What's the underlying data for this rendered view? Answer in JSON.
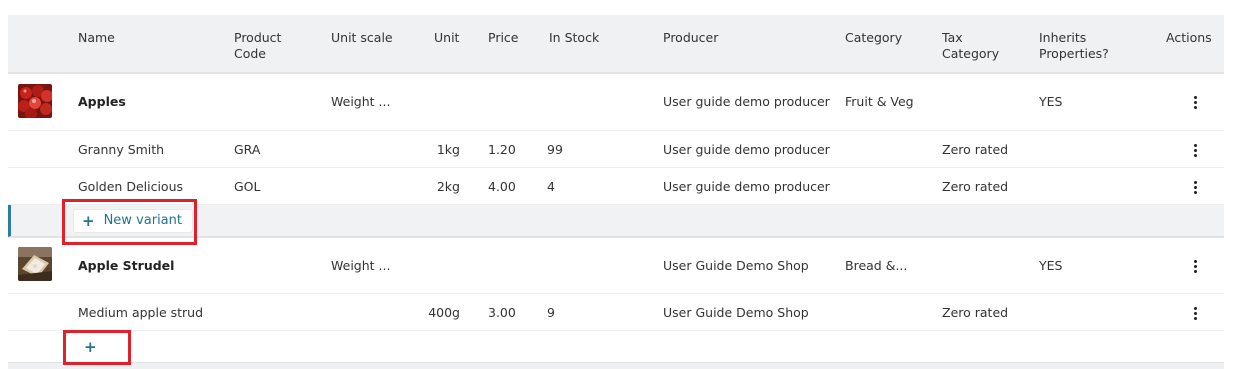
{
  "columns": {
    "name": "Name",
    "product_code_1": "Product",
    "product_code_2": "Code",
    "unit_scale": "Unit scale",
    "unit": "Unit",
    "price": "Price",
    "in_stock": "In Stock",
    "producer": "Producer",
    "category": "Category",
    "tax_category_1": "Tax",
    "tax_category_2": "Category",
    "inherits_1": "Inherits",
    "inherits_2": "Properties?",
    "actions": "Actions"
  },
  "products": [
    {
      "name": "Apples",
      "unit_scale": "Weight ...",
      "producer": "User guide demo producer",
      "category": "Fruit & Veg",
      "inherits": "YES",
      "thumb_icon": "apples-photo",
      "variants": [
        {
          "name": "Granny Smith",
          "code": "GRA",
          "unit": "1kg",
          "price": "1.20",
          "stock": "99",
          "producer": "User guide demo producer",
          "tax": "Zero rated"
        },
        {
          "name": "Golden Delicious",
          "code": "GOL",
          "unit": "2kg",
          "price": "4.00",
          "stock": "4",
          "producer": "User guide demo producer",
          "tax": "Zero rated"
        }
      ],
      "add_variant_label": "New variant"
    },
    {
      "name": "Apple Strudel",
      "unit_scale": "Weight ...",
      "producer": "User Guide Demo Shop",
      "category": "Bread &...",
      "inherits": "YES",
      "thumb_icon": "strudel-photo",
      "variants": [
        {
          "name": "Medium apple strud",
          "code": "",
          "unit": "400g",
          "price": "3.00",
          "stock": "9",
          "producer": "User Guide Demo Shop",
          "tax": "Zero rated"
        }
      ],
      "add_variant_label": ""
    }
  ],
  "colors": {
    "accent": "#287da0",
    "highlight": "#e0202a"
  }
}
